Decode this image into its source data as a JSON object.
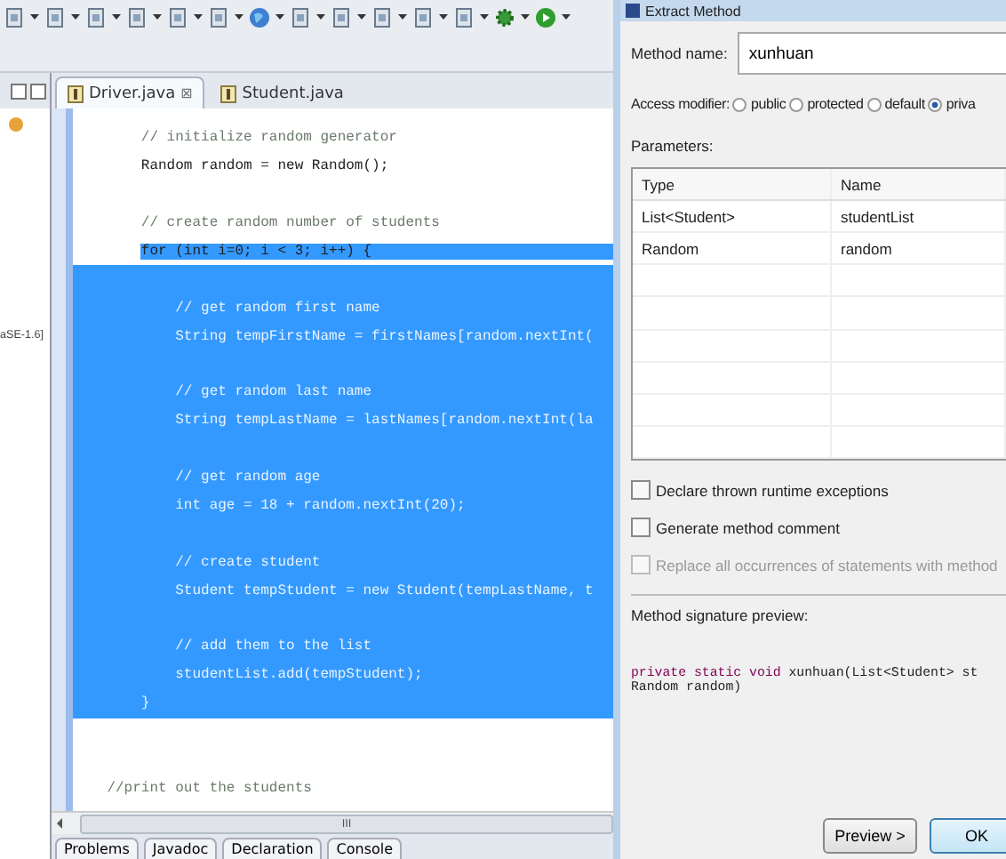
{
  "toolbar": {
    "icons": [
      {
        "kind": "tool"
      },
      {
        "kind": "tool"
      },
      {
        "kind": "tool"
      },
      {
        "kind": "tool"
      },
      {
        "kind": "tool"
      },
      {
        "kind": "tool"
      },
      {
        "kind": "globe"
      },
      {
        "kind": "tool"
      },
      {
        "kind": "tool"
      },
      {
        "kind": "tool"
      },
      {
        "kind": "tool"
      },
      {
        "kind": "tool"
      },
      {
        "kind": "gear"
      },
      {
        "kind": "run"
      }
    ]
  },
  "side_panel": {
    "label": "aSE-1.6]"
  },
  "editor": {
    "tabs": [
      {
        "label": "Driver.java",
        "selected": true,
        "close": "⊠"
      },
      {
        "label": "Student.java",
        "selected": false
      }
    ],
    "lines": [
      {
        "text": "        // initialize random generator",
        "kind": "comment",
        "selected": false
      },
      {
        "text": "        Random random = new Random();",
        "kind": "code",
        "selected": false
      },
      {
        "selected": false
      },
      {
        "text": "        // create random number of students",
        "kind": "comment",
        "selected": false
      },
      {
        "text": "        for (int i=0; i < 3; i++) {",
        "kind": "code",
        "selected": true
      },
      {
        "selected": true
      },
      {
        "text": "            // get random first name",
        "kind": "comment",
        "selected": true
      },
      {
        "text": "            String tempFirstName = firstNames[random.nextInt(",
        "kind": "code",
        "selected": true
      },
      {
        "selected": true
      },
      {
        "text": "            // get random last name",
        "kind": "comment",
        "selected": true
      },
      {
        "text": "            String tempLastName = lastNames[random.nextInt(la",
        "kind": "code",
        "selected": true
      },
      {
        "selected": true
      },
      {
        "text": "            // get random age",
        "kind": "comment",
        "selected": true
      },
      {
        "text": "            int age = 18 + random.nextInt(20);",
        "kind": "code",
        "selected": true
      },
      {
        "selected": true
      },
      {
        "text": "            // create student",
        "kind": "comment",
        "selected": true
      },
      {
        "text": "            Student tempStudent = new Student(tempLastName, t",
        "kind": "code",
        "selected": true
      },
      {
        "selected": true
      },
      {
        "text": "            // add them to the list",
        "kind": "comment",
        "selected": true
      },
      {
        "text": "            studentList.add(tempStudent);",
        "kind": "code",
        "selected": true
      },
      {
        "text": "        }",
        "kind": "code",
        "selected": true
      },
      {
        "selected": false
      },
      {
        "selected": false
      },
      {
        "text": "    //print out the students",
        "kind": "comment",
        "selected": false
      }
    ],
    "scrollbar": {
      "grip": "III"
    },
    "bottom_tabs": [
      "Problems",
      "Javadoc",
      "Declaration",
      "Console"
    ]
  },
  "dialog": {
    "title": "Extract Method",
    "method_name_label": "Method name:",
    "method_name": "xunhuan",
    "access_label": "Access modifier:",
    "modifiers": [
      {
        "label": "public",
        "selected": false
      },
      {
        "label": "protected",
        "selected": false
      },
      {
        "label": "default",
        "selected": false
      },
      {
        "label": "priva",
        "selected": true
      }
    ],
    "parameters_label": "Parameters:",
    "table": {
      "columns": [
        "Type",
        "Name"
      ],
      "rows": [
        [
          "List<Student>",
          "studentList"
        ],
        [
          "Random",
          "random"
        ]
      ]
    },
    "options": [
      {
        "label": "Declare thrown runtime exceptions",
        "checked": false,
        "disabled": false
      },
      {
        "label": "Generate method comment",
        "checked": false,
        "disabled": false
      },
      {
        "label": "Replace all occurrences of statements with method",
        "checked": false,
        "disabled": true
      }
    ],
    "preview_label": "Method signature preview:",
    "preview_lines": [
      [
        {
          "text": "private static void",
          "kind": "keyword"
        },
        {
          "text": " xunhuan(List<Student> st",
          "kind": "plain"
        }
      ],
      [
        {
          "text": "Random random)",
          "kind": "plain"
        }
      ]
    ],
    "buttons": [
      "Preview >",
      "OK"
    ]
  }
}
